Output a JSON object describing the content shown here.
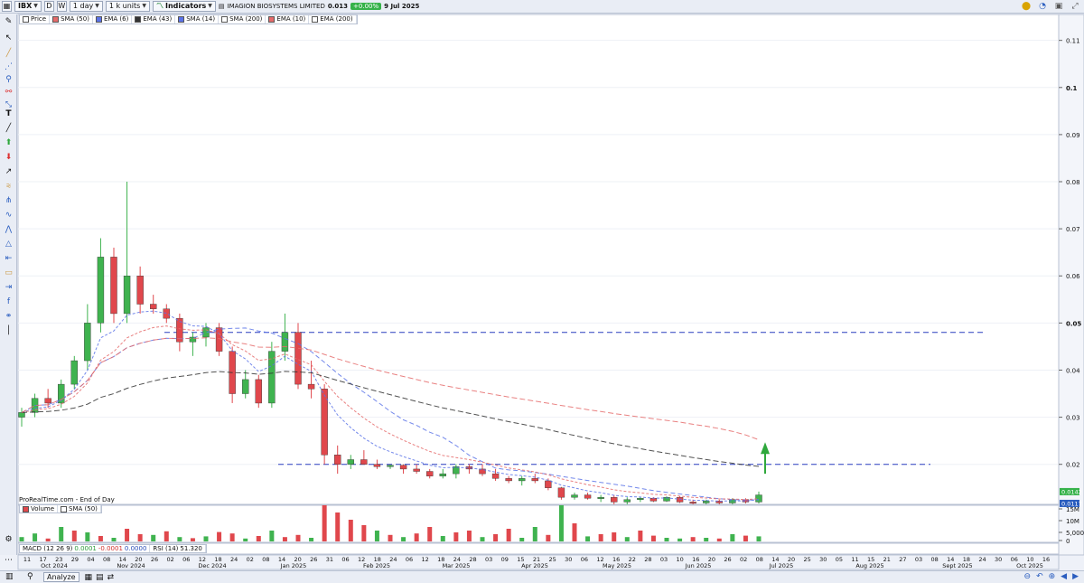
{
  "toolbar": {
    "ticker": "IBX",
    "d_btn": "D",
    "w_btn": "W",
    "timeframe": "1 day",
    "units": "1 k units",
    "indicators": "Indicators",
    "instrument": "IMAGION BIOSYSTEMS LIMITED",
    "price": "0.013",
    "change": "+0.00%",
    "date": "9 Jul 2025"
  },
  "legend": {
    "price": "Price",
    "items": [
      "SMA (50)",
      "EMA (6)",
      "EMA (43)",
      "SMA (14)",
      "SMA (200)",
      "EMA (10)",
      "EMA (200)"
    ]
  },
  "source_text": "ProRealTime.com - End of Day",
  "volume_legend": {
    "volume": "Volume",
    "sma": "SMA (50)"
  },
  "indicator_legend": {
    "macd": "MACD (12 26 9)",
    "macd_v1": "0.0001",
    "macd_v2": "-0.0001",
    "macd_v3": "0.0000",
    "rsi": "RSI (14)",
    "rsi_val": "51.320"
  },
  "bottom": {
    "analyze": "Analyze"
  },
  "colors": {
    "up": "#3fb34f",
    "down": "#e0474c",
    "hline": "#2a3fbf",
    "arrow": "#2fa83c"
  },
  "chart_data": {
    "type": "candlestick",
    "title": "IMAGION BIOSYSTEMS LIMITED",
    "price_axis": {
      "ticks": [
        0.11,
        0.1,
        0.09,
        0.08,
        0.07,
        0.06,
        0.05,
        0.04,
        0.03,
        0.02
      ],
      "range": [
        0.0115,
        0.1155
      ]
    },
    "price_tags": [
      "0.0142",
      "0.0117"
    ],
    "volume_axis": {
      "ticks": [
        "15M",
        "10M",
        "5,000k",
        "0"
      ],
      "range": [
        0,
        18000000
      ]
    },
    "x_axis": {
      "day_ticks": [
        "11",
        "17",
        "23",
        "29",
        "04",
        "08",
        "14",
        "20",
        "26",
        "02",
        "06",
        "12",
        "18",
        "24",
        "02",
        "08",
        "14",
        "20",
        "26",
        "31",
        "06",
        "12",
        "18",
        "24",
        "06",
        "12",
        "18",
        "24",
        "28",
        "03",
        "09",
        "15",
        "21",
        "25",
        "30",
        "06",
        "12",
        "16",
        "22",
        "28",
        "03",
        "10",
        "16",
        "20",
        "26",
        "02",
        "08",
        "14",
        "20",
        "25",
        "30",
        "05",
        "11",
        "15",
        "21",
        "27",
        "03",
        "08",
        "14",
        "18",
        "24",
        "30",
        "06",
        "10",
        "16"
      ],
      "months": [
        "Oct 2024",
        "Nov 2024",
        "Dec 2024",
        "Jan 2025",
        "Feb 2025",
        "Mar 2025",
        "Apr 2025",
        "May 2025",
        "Jun 2025",
        "Jul 2025",
        "Aug 2025",
        "Sept 2025",
        "Oct 2025"
      ]
    },
    "horizontal_lines": [
      0.048,
      0.02
    ],
    "candles": [
      [
        0.03,
        0.032,
        0.028,
        0.031
      ],
      [
        0.031,
        0.035,
        0.03,
        0.034
      ],
      [
        0.034,
        0.036,
        0.032,
        0.033
      ],
      [
        0.033,
        0.038,
        0.032,
        0.037
      ],
      [
        0.037,
        0.043,
        0.036,
        0.042
      ],
      [
        0.042,
        0.054,
        0.04,
        0.05
      ],
      [
        0.05,
        0.068,
        0.048,
        0.064
      ],
      [
        0.064,
        0.066,
        0.05,
        0.052
      ],
      [
        0.052,
        0.08,
        0.05,
        0.06
      ],
      [
        0.06,
        0.062,
        0.052,
        0.054
      ],
      [
        0.054,
        0.056,
        0.052,
        0.053
      ],
      [
        0.053,
        0.054,
        0.05,
        0.051
      ],
      [
        0.051,
        0.052,
        0.044,
        0.046
      ],
      [
        0.046,
        0.048,
        0.043,
        0.047
      ],
      [
        0.047,
        0.05,
        0.045,
        0.049
      ],
      [
        0.049,
        0.05,
        0.043,
        0.044
      ],
      [
        0.044,
        0.045,
        0.033,
        0.035
      ],
      [
        0.035,
        0.04,
        0.034,
        0.038
      ],
      [
        0.038,
        0.039,
        0.032,
        0.033
      ],
      [
        0.033,
        0.046,
        0.032,
        0.044
      ],
      [
        0.044,
        0.052,
        0.042,
        0.048
      ],
      [
        0.048,
        0.05,
        0.036,
        0.037
      ],
      [
        0.037,
        0.042,
        0.034,
        0.036
      ],
      [
        0.036,
        0.037,
        0.02,
        0.022
      ],
      [
        0.022,
        0.024,
        0.018,
        0.02
      ],
      [
        0.02,
        0.022,
        0.019,
        0.021
      ],
      [
        0.021,
        0.023,
        0.02,
        0.02
      ],
      [
        0.02,
        0.021,
        0.019,
        0.0195
      ],
      [
        0.0195,
        0.02,
        0.019,
        0.0198
      ],
      [
        0.0198,
        0.02,
        0.018,
        0.019
      ],
      [
        0.019,
        0.02,
        0.018,
        0.0185
      ],
      [
        0.0185,
        0.019,
        0.017,
        0.0175
      ],
      [
        0.0175,
        0.019,
        0.017,
        0.018
      ],
      [
        0.018,
        0.02,
        0.017,
        0.0195
      ],
      [
        0.0195,
        0.02,
        0.018,
        0.019
      ],
      [
        0.019,
        0.02,
        0.0175,
        0.018
      ],
      [
        0.018,
        0.019,
        0.0165,
        0.017
      ],
      [
        0.017,
        0.0175,
        0.016,
        0.0165
      ],
      [
        0.0165,
        0.0175,
        0.0155,
        0.017
      ],
      [
        0.017,
        0.018,
        0.016,
        0.0165
      ],
      [
        0.0165,
        0.017,
        0.0145,
        0.015
      ],
      [
        0.015,
        0.0152,
        0.0125,
        0.013
      ],
      [
        0.013,
        0.014,
        0.0125,
        0.0135
      ],
      [
        0.0135,
        0.014,
        0.0125,
        0.0128
      ],
      [
        0.0128,
        0.0135,
        0.012,
        0.013
      ],
      [
        0.013,
        0.0135,
        0.0115,
        0.012
      ],
      [
        0.012,
        0.013,
        0.0115,
        0.0125
      ],
      [
        0.0125,
        0.013,
        0.012,
        0.0128
      ],
      [
        0.0128,
        0.013,
        0.012,
        0.0122
      ],
      [
        0.0122,
        0.0132,
        0.012,
        0.013
      ],
      [
        0.013,
        0.0132,
        0.0118,
        0.012
      ],
      [
        0.012,
        0.0125,
        0.0115,
        0.0118
      ],
      [
        0.0118,
        0.0125,
        0.0115,
        0.0122
      ],
      [
        0.0122,
        0.0125,
        0.0115,
        0.0118
      ],
      [
        0.0118,
        0.0128,
        0.0115,
        0.0125
      ],
      [
        0.0125,
        0.0128,
        0.0117,
        0.012
      ],
      [
        0.012,
        0.0142,
        0.0117,
        0.0135
      ]
    ],
    "volume_bars": [
      [
        12,
        "up"
      ],
      [
        22,
        "up"
      ],
      [
        8,
        "down"
      ],
      [
        40,
        "up"
      ],
      [
        30,
        "down"
      ],
      [
        25,
        "up"
      ],
      [
        15,
        "down"
      ],
      [
        10,
        "up"
      ],
      [
        35,
        "down"
      ],
      [
        20,
        "down"
      ],
      [
        18,
        "up"
      ],
      [
        28,
        "down"
      ],
      [
        12,
        "up"
      ],
      [
        9,
        "down"
      ],
      [
        14,
        "up"
      ],
      [
        26,
        "down"
      ],
      [
        22,
        "down"
      ],
      [
        8,
        "up"
      ],
      [
        15,
        "down"
      ],
      [
        30,
        "up"
      ],
      [
        12,
        "down"
      ],
      [
        18,
        "down"
      ],
      [
        10,
        "up"
      ],
      [
        100,
        "down"
      ],
      [
        80,
        "down"
      ],
      [
        60,
        "down"
      ],
      [
        45,
        "down"
      ],
      [
        30,
        "up"
      ],
      [
        18,
        "down"
      ],
      [
        12,
        "up"
      ],
      [
        22,
        "down"
      ],
      [
        40,
        "down"
      ],
      [
        15,
        "up"
      ],
      [
        25,
        "down"
      ],
      [
        30,
        "down"
      ],
      [
        12,
        "up"
      ],
      [
        20,
        "down"
      ],
      [
        35,
        "down"
      ],
      [
        10,
        "up"
      ],
      [
        40,
        "up"
      ],
      [
        18,
        "down"
      ],
      [
        100,
        "up"
      ],
      [
        50,
        "down"
      ],
      [
        14,
        "up"
      ],
      [
        20,
        "down"
      ],
      [
        25,
        "down"
      ],
      [
        12,
        "up"
      ],
      [
        30,
        "down"
      ],
      [
        16,
        "down"
      ],
      [
        10,
        "up"
      ],
      [
        8,
        "up"
      ],
      [
        12,
        "down"
      ],
      [
        10,
        "up"
      ],
      [
        8,
        "down"
      ],
      [
        20,
        "up"
      ],
      [
        16,
        "down"
      ],
      [
        14,
        "up"
      ]
    ]
  }
}
